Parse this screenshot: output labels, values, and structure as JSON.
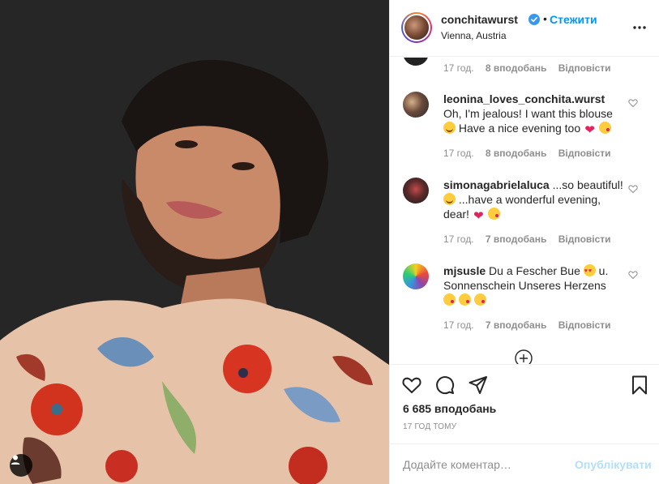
{
  "post": {
    "photo_alt": "",
    "photo_icons": {
      "user_tag": "user-tag-icon"
    }
  },
  "header": {
    "username": "conchitawurst",
    "verified_icon": "verified-badge-icon",
    "separator": "•",
    "follow_label": "Стежити",
    "location": "Vienna, Austria",
    "more_icon": "more-options-icon"
  },
  "comments": {
    "partial_meta": {
      "time": "17 год.",
      "likes": "8 вподобань",
      "reply": "Відповісти"
    },
    "items": [
      {
        "username": "leonina_loves_conchita.wurst",
        "text_parts": [
          "Oh, I'm jealous! I want this blouse",
          "Have a nice evening too"
        ],
        "time": "17 год.",
        "likes": "8 вподобань",
        "reply": "Відповісти"
      },
      {
        "username": "simonagabrielaluca",
        "text_parts": [
          "...so beautiful!",
          "...have a wonderful evening, dear!"
        ],
        "time": "17 год.",
        "likes": "7 вподобань",
        "reply": "Відповісти"
      },
      {
        "username": "mjsusle",
        "text_parts": [
          "Du a Fescher Bue",
          "u. Sonnenschein Unseres Herzens"
        ],
        "time": "17 год.",
        "likes": "7 вподобань",
        "reply": "Відповісти"
      }
    ],
    "load_more_icon": "plus-circle-icon"
  },
  "actions": {
    "icons": [
      "heart-icon",
      "comment-icon",
      "share-icon",
      "bookmark-icon"
    ],
    "likes_count": "6 685 вподобань",
    "timestamp": "17 ГОД ТОМУ"
  },
  "add_comment": {
    "placeholder": "Додайте коментар…",
    "value": "",
    "publish_label": "Опублікувати",
    "publish_color": "#b2dffc"
  },
  "colors": {
    "accent": "#0095f6",
    "text": "#262626",
    "muted": "#8e8e8e",
    "border": "#efefef"
  }
}
